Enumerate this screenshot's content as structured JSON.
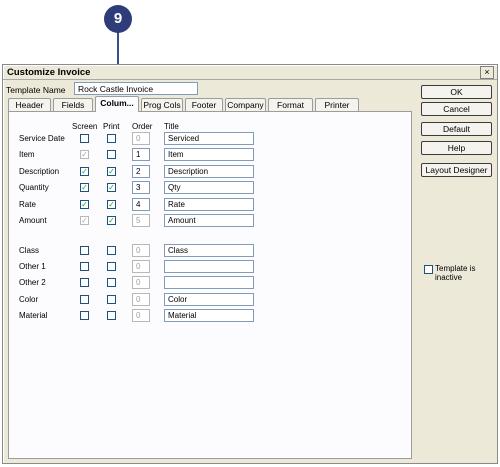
{
  "callout": {
    "number": "9"
  },
  "dialog": {
    "title": "Customize Invoice",
    "close_glyph": "×",
    "template_name_label": "Template Name",
    "template_name_value": "Rock Castle Invoice"
  },
  "tabs": [
    "Header",
    "Fields",
    "Colum...",
    "Prog Cols",
    "Footer",
    "Company",
    "Format",
    "Printer"
  ],
  "active_tab": "Colum...",
  "columns": {
    "headers": {
      "screen": "Screen",
      "print": "Print",
      "order": "Order",
      "title": "Title"
    },
    "rows": [
      {
        "label": "Service Date",
        "screen": false,
        "print": false,
        "order": "0",
        "title": "Serviced",
        "order_disabled": true,
        "screen_disabled": false
      },
      {
        "label": "Item",
        "screen": true,
        "print": false,
        "order": "1",
        "title": "Item",
        "order_disabled": false,
        "screen_disabled": true
      },
      {
        "label": "Description",
        "screen": true,
        "print": true,
        "order": "2",
        "title": "Description",
        "order_disabled": false,
        "screen_disabled": false
      },
      {
        "label": "Quantity",
        "screen": true,
        "print": true,
        "order": "3",
        "title": "Qty",
        "order_disabled": false,
        "screen_disabled": false
      },
      {
        "label": "Rate",
        "screen": true,
        "print": true,
        "order": "4",
        "title": "Rate",
        "order_disabled": false,
        "screen_disabled": false
      },
      {
        "label": "Amount",
        "screen": true,
        "print": true,
        "order": "5",
        "title": "Amount",
        "order_disabled": true,
        "screen_disabled": true
      },
      {
        "label": "Class",
        "screen": false,
        "print": false,
        "order": "0",
        "title": "Class",
        "order_disabled": true,
        "screen_disabled": false
      },
      {
        "label": "Other 1",
        "screen": false,
        "print": false,
        "order": "0",
        "title": "",
        "order_disabled": true,
        "screen_disabled": false
      },
      {
        "label": "Other 2",
        "screen": false,
        "print": false,
        "order": "0",
        "title": "",
        "order_disabled": true,
        "screen_disabled": false
      },
      {
        "label": "Color",
        "screen": false,
        "print": false,
        "order": "0",
        "title": "Color",
        "order_disabled": true,
        "screen_disabled": false
      },
      {
        "label": "Material",
        "screen": false,
        "print": false,
        "order": "0",
        "title": "Material",
        "order_disabled": true,
        "screen_disabled": false
      }
    ]
  },
  "buttons": {
    "ok": "OK",
    "cancel": "Cancel",
    "default": "Default",
    "help": "Help",
    "layout_designer": "Layout Designer"
  },
  "template_inactive": {
    "label": "Template is inactive",
    "checked": false
  },
  "check_glyph": "✓",
  "colors": {
    "accent": "#2e3c7a",
    "dialog_bg": "#ece9d8",
    "check": "#21a121"
  }
}
